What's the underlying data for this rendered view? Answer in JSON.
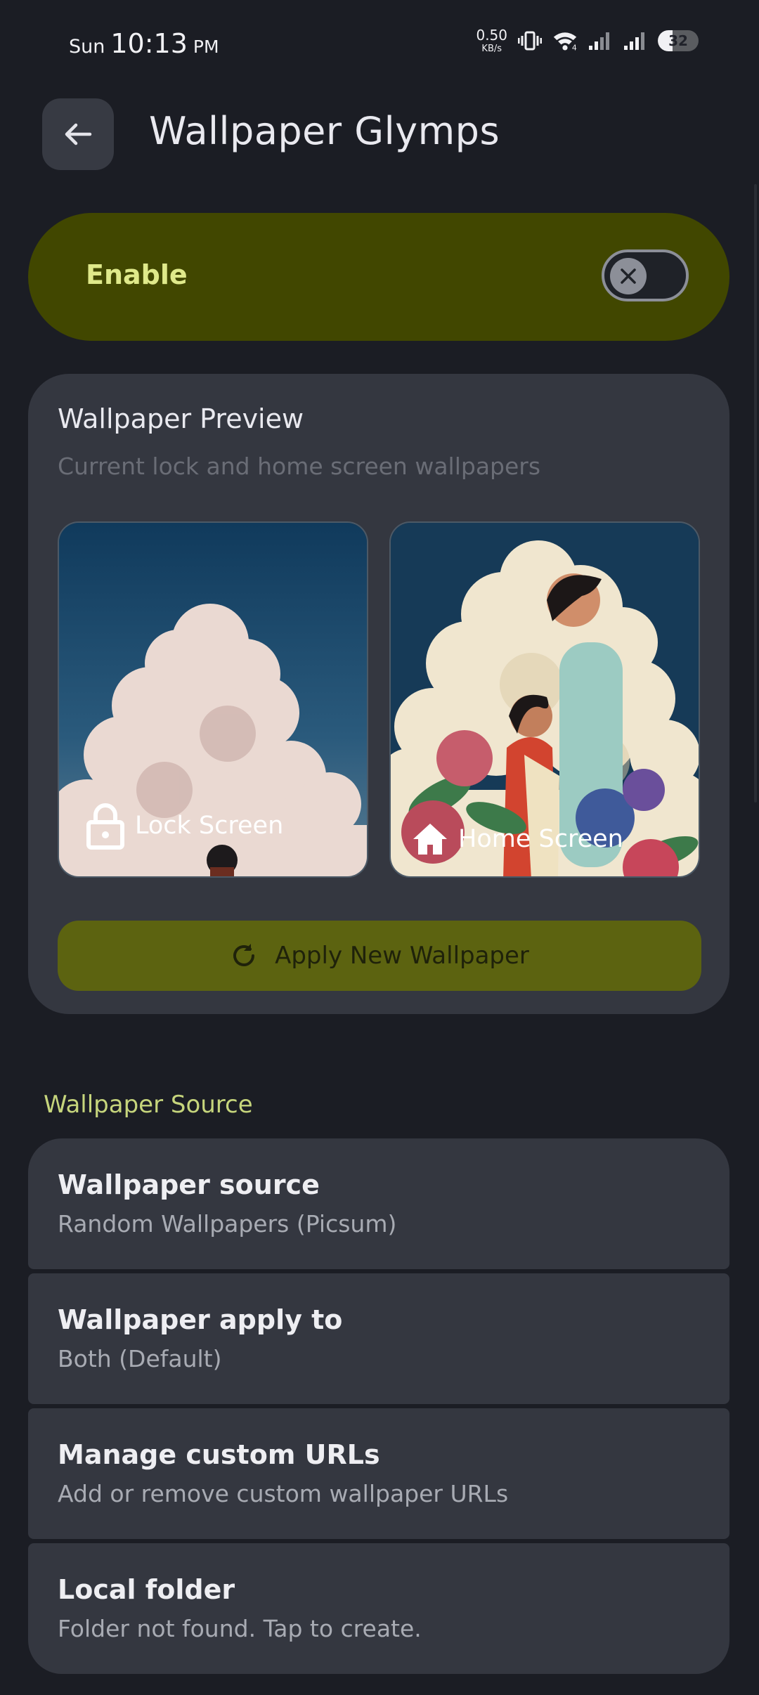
{
  "status_bar": {
    "day": "Sun",
    "time": "10:13",
    "ampm": "PM",
    "net_speed_value": "0.50",
    "net_speed_unit": "KB/s",
    "battery": "32",
    "icons": [
      "vibrate-icon",
      "wifi-icon",
      "signal-icon",
      "signal-icon-2",
      "battery-icon"
    ]
  },
  "header": {
    "title": "Wallpaper Glymps",
    "back_icon": "arrow-back-icon"
  },
  "enable": {
    "label": "Enable",
    "toggle_on": false
  },
  "preview": {
    "title": "Wallpaper Preview",
    "subtitle": "Current lock and home screen wallpapers",
    "lock_label": "Lock Screen",
    "home_label": "Home Screen",
    "apply_label": "Apply New Wallpaper"
  },
  "section": {
    "title": "Wallpaper Source",
    "items": [
      {
        "title": "Wallpaper source",
        "subtitle": "Random Wallpapers (Picsum)"
      },
      {
        "title": "Wallpaper apply to",
        "subtitle": "Both (Default)"
      },
      {
        "title": "Manage custom URLs",
        "subtitle": "Add or remove custom wallpaper URLs"
      },
      {
        "title": "Local folder",
        "subtitle": "Folder not found. Tap to create."
      }
    ]
  },
  "colors": {
    "background": "#1b1d24",
    "card": "#343740",
    "enable_card": "#414700",
    "accent_text": "#dfe98a",
    "apply_button": "#5c6310",
    "section_title": "#c6d57c"
  }
}
